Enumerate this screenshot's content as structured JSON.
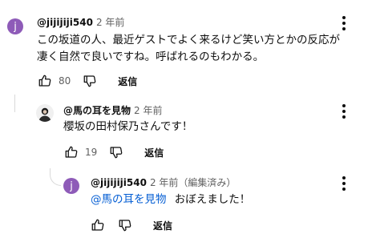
{
  "comments": [
    {
      "avatar_letter": "j",
      "avatar_color": "#8e5bb8",
      "author": "@jijijiji540",
      "time": "2 年前",
      "text_line1": "この坂道の人、最近ゲストでよく来るけど笑い方とかの反応が",
      "text_line2": "凄く自然で良いですね。呼ばれるのもわかる。",
      "likes": "80",
      "reply_label": "返信",
      "like_icon": "thumbs-up-icon",
      "dislike_icon": "thumbs-down-icon",
      "menu_icon": "more-vert-icon"
    },
    {
      "author": "@馬の耳を見物",
      "time": "2 年前",
      "text": "櫻坂の田村保乃さんです！",
      "likes": "19",
      "reply_label": "返信",
      "like_icon": "thumbs-up-icon",
      "dislike_icon": "thumbs-down-icon",
      "menu_icon": "more-vert-icon"
    },
    {
      "avatar_letter": "j",
      "avatar_color": "#8e5bb8",
      "author": "@jijijiji540",
      "time": "2 年前（編集済み）",
      "mention": "@馬の耳を見物",
      "text": "おぼえました！",
      "reply_label": "返信",
      "like_icon": "thumbs-up-icon",
      "dislike_icon": "thumbs-down-icon",
      "menu_icon": "more-vert-icon"
    }
  ]
}
